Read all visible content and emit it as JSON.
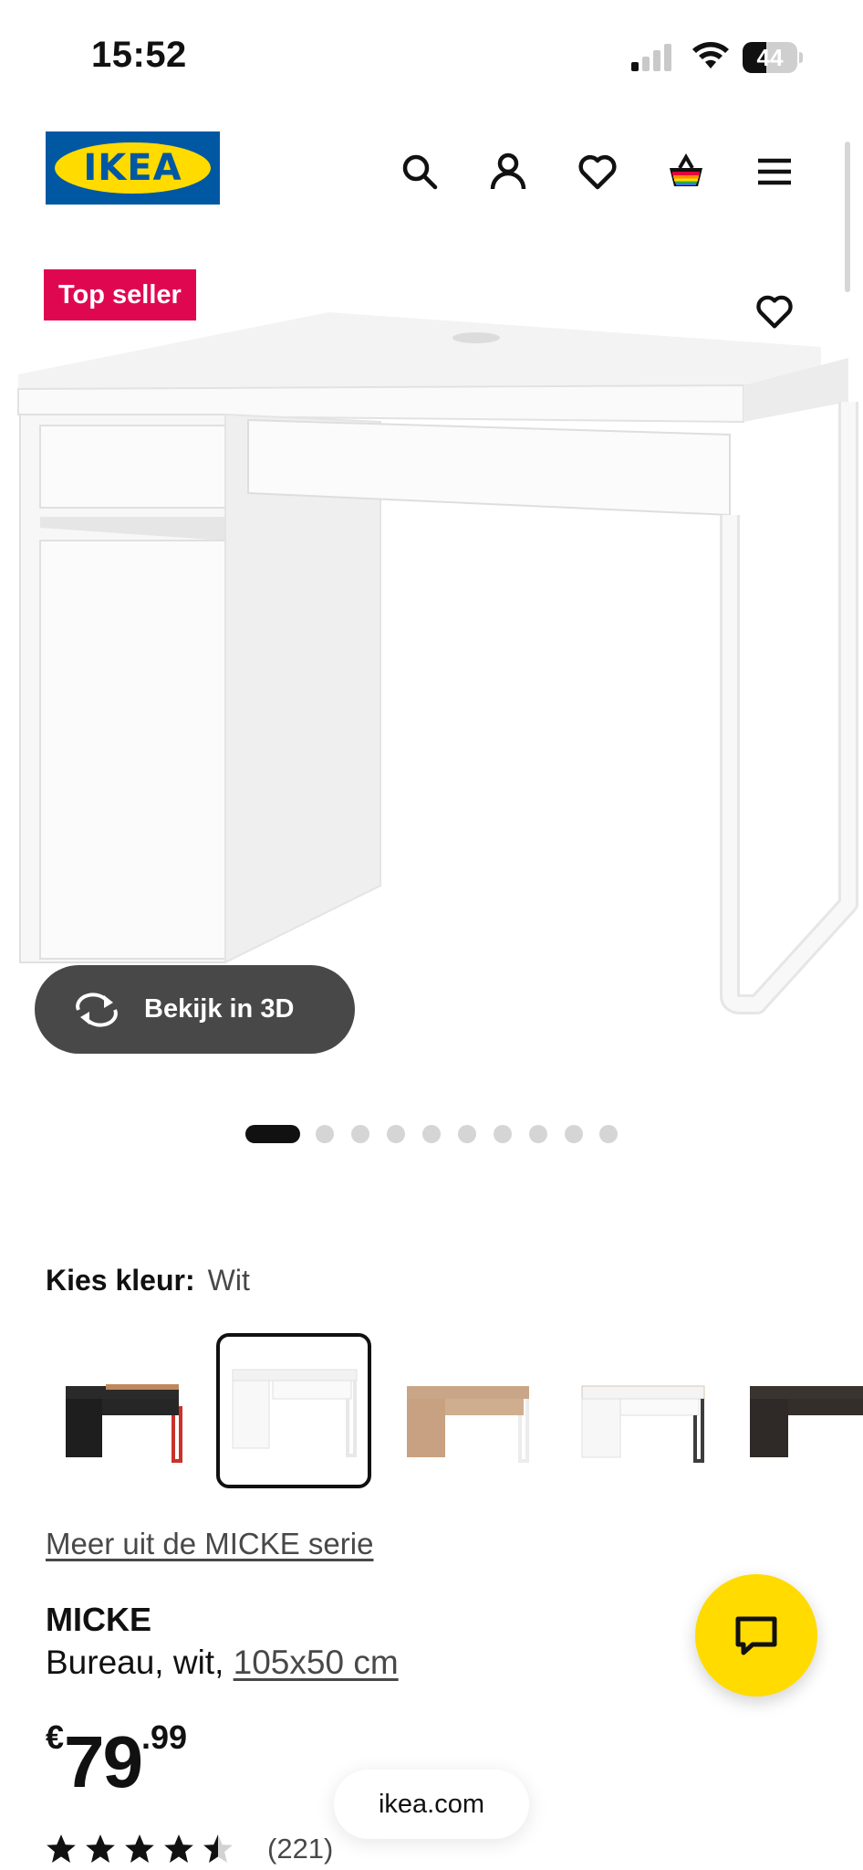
{
  "status_bar": {
    "time": "15:52",
    "battery": "44",
    "battery_level": 0.44
  },
  "header": {
    "logo_text": "IKEA",
    "icons": [
      "search-icon",
      "account-icon",
      "heart-icon",
      "basket-icon",
      "menu-icon"
    ]
  },
  "gallery": {
    "badge": "Top seller",
    "view_3d_label": "Bekijk in 3D",
    "slide_count": 10,
    "active_slide": 1
  },
  "color_picker": {
    "label": "Kies kleur:",
    "selected": "Wit",
    "swatches": [
      "zwart-rood",
      "wit",
      "eikeneffect",
      "wit-antraciet",
      "zwartbruin"
    ]
  },
  "product": {
    "series_link": "Meer uit de MICKE serie",
    "name": "MICKE",
    "description": "Bureau, wit,",
    "dimensions": "105x50 cm",
    "price_currency": "€",
    "price_int": "79",
    "price_dec": ".99",
    "rating_value": 4.5,
    "rating_max": 5,
    "review_count": "(221)"
  },
  "browser": {
    "url": "ikea.com"
  },
  "colors": {
    "brand_blue": "#0058a3",
    "brand_yellow": "#ffdb00",
    "badge_red": "#e00751"
  }
}
